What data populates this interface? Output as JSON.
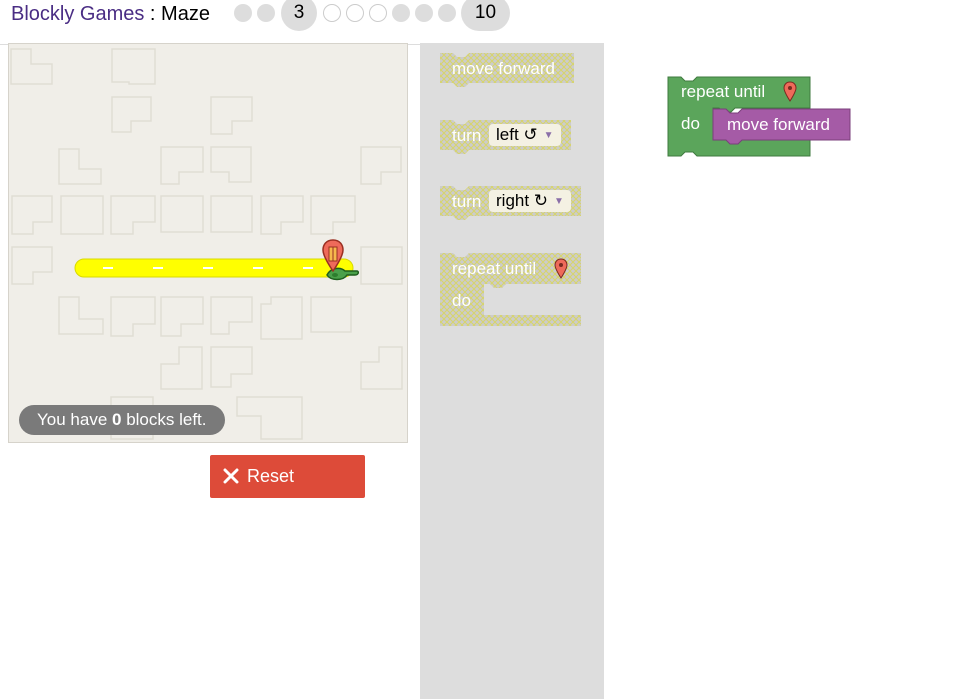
{
  "header": {
    "app_name": "Blockly Games",
    "separator": " : ",
    "game_name": "Maze",
    "levels": [
      {
        "label": "",
        "state": "done"
      },
      {
        "label": "",
        "state": "done"
      },
      {
        "label": "3",
        "state": "current"
      },
      {
        "label": "",
        "state": "todo"
      },
      {
        "label": "",
        "state": "todo"
      },
      {
        "label": "",
        "state": "todo"
      },
      {
        "label": "",
        "state": "done"
      },
      {
        "label": "",
        "state": "done"
      },
      {
        "label": "",
        "state": "done"
      },
      {
        "label": "10",
        "state": "last"
      }
    ]
  },
  "maze": {
    "path_color": "#ffff00",
    "capacity_prefix": "You have ",
    "capacity_count": "0",
    "capacity_suffix": " blocks left."
  },
  "reset": {
    "label": "Reset",
    "color": "#dd4b39"
  },
  "toolbox": {
    "move_forward": "move forward",
    "turn_left": {
      "label": "turn",
      "option": "left ↺"
    },
    "turn_right": {
      "label": "turn",
      "option": "right ↻"
    },
    "repeat_until": "repeat until",
    "do": "do"
  },
  "workspace": {
    "repeat_until": "repeat until",
    "do": "do",
    "move_forward": "move forward",
    "loop_color": "#5ba55b",
    "movement_color": "#a55ba6"
  },
  "icons": {
    "goal": "map-marker-icon",
    "player": "pegman-icon",
    "reset": "close-icon",
    "dropdown": "dropdown-arrow-icon"
  }
}
